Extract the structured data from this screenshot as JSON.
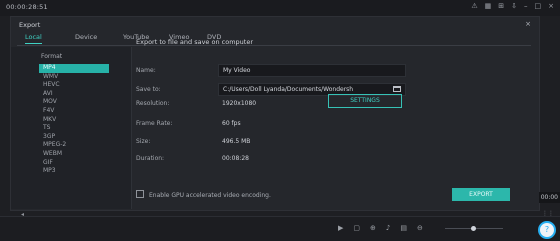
{
  "app": {
    "timecode": "00:00:28:51",
    "top_icons": [
      "⚠",
      "▦",
      "⊞",
      "⇩",
      "–",
      "□",
      "×"
    ]
  },
  "dialog": {
    "title": "Export",
    "close": "×",
    "tabs": [
      "Local",
      "Device",
      "YouTube",
      "Vimeo",
      "DVD"
    ],
    "active_tab": "Local",
    "formats_header": "Format",
    "formats": [
      "MP4",
      "WMV",
      "HEVC",
      "AVI",
      "MOV",
      "F4V",
      "MKV",
      "TS",
      "3GP",
      "MPEG-2",
      "WEBM",
      "GIF",
      "MP3"
    ],
    "selected_format": "MP4",
    "heading": "Export to file and save on computer",
    "name_label": "Name:",
    "name_value": "My Video",
    "save_to_label": "Save to:",
    "save_to_value": "C:/Users/Doll Lyanda/Documents/Wondersh",
    "resolution_label": "Resolution:",
    "resolution_value": "1920x1080",
    "settings_button": "SETTINGS",
    "frame_rate_label": "Frame Rate:",
    "frame_rate_value": "60 fps",
    "size_label": "Size:",
    "size_value": "496.5 MB",
    "duration_label": "Duration:",
    "duration_value": "00:08:28",
    "gpu_label": "Enable GPU accelerated video encoding.",
    "export_button": "EXPORT"
  },
  "right_panel": {
    "time": "00:00"
  },
  "bottom_bar": {
    "icons": [
      "▶",
      "▢",
      "⊕",
      "♪",
      "▤",
      "⊖"
    ],
    "help_icon": "?"
  }
}
